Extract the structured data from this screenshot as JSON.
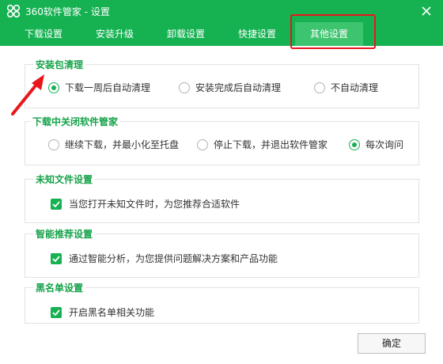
{
  "window": {
    "title": "360软件管家 - 设置",
    "icon": "clover-logo-icon",
    "close_icon": "close-icon"
  },
  "tabs": [
    {
      "label": "下载设置",
      "active": false
    },
    {
      "label": "安装升级",
      "active": false
    },
    {
      "label": "卸载设置",
      "active": false
    },
    {
      "label": "快捷设置",
      "active": false
    },
    {
      "label": "其他设置",
      "active": true
    }
  ],
  "sections": {
    "cleanup": {
      "title": "安装包清理",
      "options": [
        {
          "label": "下载一周后自动清理",
          "checked": true
        },
        {
          "label": "安装完成后自动清理",
          "checked": false
        },
        {
          "label": "不自动清理",
          "checked": false
        }
      ]
    },
    "close_during_download": {
      "title": "下载中关闭软件管家",
      "options": [
        {
          "label": "继续下载，并最小化至托盘",
          "checked": false
        },
        {
          "label": "停止下载，并退出软件管家",
          "checked": false
        },
        {
          "label": "每次询问",
          "checked": true
        }
      ]
    },
    "unknown_files": {
      "title": "未知文件设置",
      "checkbox": {
        "label": "当您打开未知文件时，为您推荐合适软件",
        "checked": true
      }
    },
    "smart_recommend": {
      "title": "智能推荐设置",
      "checkbox": {
        "label": "通过智能分析，为您提供问题解决方案和产品功能",
        "checked": true
      }
    },
    "blacklist": {
      "title": "黑名单设置",
      "checkbox": {
        "label": "开启黑名单相关功能",
        "checked": true
      }
    }
  },
  "ok_button": "确定",
  "colors": {
    "brand_green": "#16b252",
    "active_tab": "#3cc46e",
    "section_title": "#16a34a",
    "annotation_red": "#e8161c"
  }
}
